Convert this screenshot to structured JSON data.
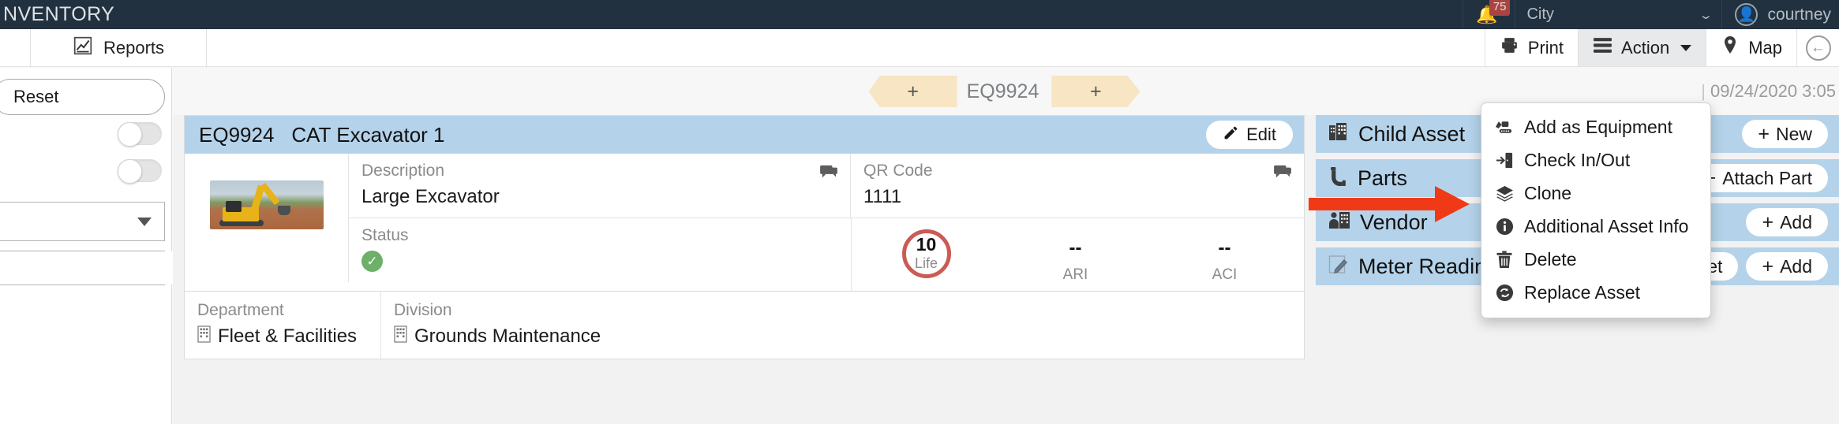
{
  "topbar": {
    "brand": "NVENTORY",
    "notification_count": "75",
    "bell_icon": "bell-icon",
    "city_label": "City",
    "city_caret_icon": "chevron-down-icon",
    "avatar_icon": "user-avatar-icon",
    "user_name": "courtney"
  },
  "toolbar": {
    "reports_label": "Reports",
    "reports_icon": "chart-report-icon",
    "print_label": "Print",
    "print_icon": "printer-icon",
    "action_label": "Action",
    "action_icon": "hamburger-menu-icon",
    "map_label": "Map",
    "map_icon": "map-marker-icon",
    "back_icon": "back-arrow-circle-icon"
  },
  "sidebar": {
    "reset_label": "Reset",
    "toggle_one": "toggle-switch-off",
    "toggle_two": "toggle-switch-off",
    "select_value": "",
    "search_value": "",
    "search_placeholder": "",
    "search_icon": "search-icon",
    "select_caret_icon": "caret-down-icon"
  },
  "breadcrumb": {
    "add_left_label": "+",
    "code": "EQ9924",
    "add_right_label": "+",
    "date": "09/24/2020 3:05",
    "divider": "|"
  },
  "asset": {
    "code": "EQ9924",
    "name": "CAT Excavator 1",
    "edit_label": "Edit",
    "edit_icon": "pencil-icon",
    "thumbnail_alt": "excavator-photo",
    "description_label": "Description",
    "description_value": "Large Excavator",
    "qr_label": "QR Code",
    "qr_value": "1111",
    "status_label": "Status",
    "status_icon": "check-circle-icon",
    "comment_icon": "comment-icon",
    "metrics": [
      {
        "value": "10",
        "caption": "Life",
        "ring": true,
        "ring_color": "#cb5b55"
      },
      {
        "value": "--",
        "caption": "ARI",
        "ring": false
      },
      {
        "value": "--",
        "caption": "ACI",
        "ring": false
      }
    ],
    "department_label": "Department",
    "department_value": "Fleet & Facilities",
    "division_label": "Division",
    "division_value": "Grounds Maintenance",
    "building_icon": "building-icon"
  },
  "sections": [
    {
      "title": "Child Asset",
      "icon": "building-multi-icon",
      "buttons": [
        {
          "label": "New",
          "icon": "plus-icon"
        }
      ]
    },
    {
      "title": "Parts",
      "icon": "pipe-elbow-icon",
      "buttons": [
        {
          "label": "Attach Part",
          "icon": "plus-icon"
        }
      ]
    },
    {
      "title": "Vendor",
      "icon": "vendor-person-building-icon",
      "buttons": [
        {
          "label": "Add",
          "icon": "plus-icon"
        }
      ]
    },
    {
      "title": "Meter Reading",
      "icon": "meter-note-icon",
      "buttons": [
        {
          "label": "Reset",
          "icon": "refresh-icon"
        },
        {
          "label": "Add",
          "icon": "plus-icon"
        }
      ]
    }
  ],
  "action_menu": {
    "items": [
      {
        "label": "Add as Equipment",
        "icon": "excavator-icon"
      },
      {
        "label": "Check In/Out",
        "icon": "check-in-out-icon"
      },
      {
        "label": "Clone",
        "icon": "layers-icon"
      },
      {
        "label": "Additional Asset Info",
        "icon": "info-circle-icon"
      },
      {
        "label": "Delete",
        "icon": "trash-icon"
      },
      {
        "label": "Replace Asset",
        "icon": "refresh-circle-icon"
      }
    ]
  },
  "annotation": {
    "arrow_color": "#f03a17",
    "arrow_target": "Replace Asset"
  },
  "colors": {
    "navbar": "#22313f",
    "section_header": "#b4d3ea",
    "badge_red": "#a94442",
    "chip_tan": "#f7e5c4",
    "status_green": "#6cb069",
    "ring_red": "#cb5b55"
  }
}
